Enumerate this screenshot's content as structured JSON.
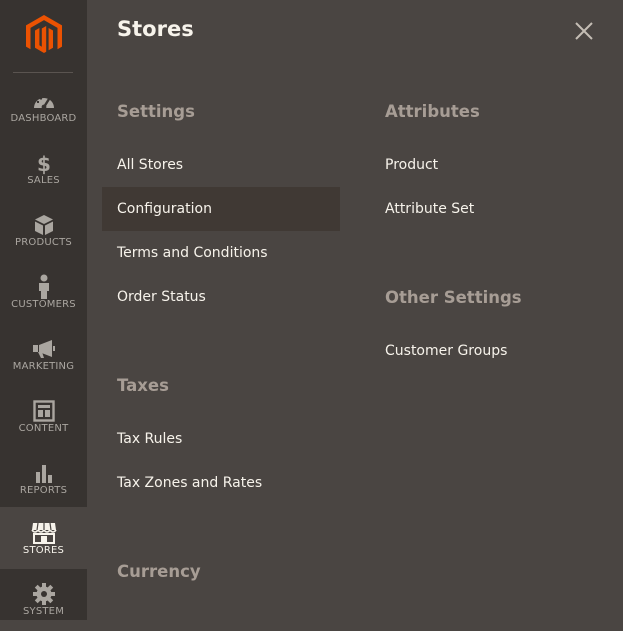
{
  "sidebar": {
    "logo": "magento-logo-icon",
    "items": [
      {
        "label": "DASHBOARD",
        "icon": "dashboard-gauge-icon"
      },
      {
        "label": "SALES",
        "icon": "dollar-icon"
      },
      {
        "label": "PRODUCTS",
        "icon": "box-icon"
      },
      {
        "label": "CUSTOMERS",
        "icon": "person-icon"
      },
      {
        "label": "MARKETING",
        "icon": "megaphone-icon"
      },
      {
        "label": "CONTENT",
        "icon": "layout-icon"
      },
      {
        "label": "REPORTS",
        "icon": "bar-chart-icon"
      },
      {
        "label": "STORES",
        "icon": "storefront-icon",
        "active": true
      },
      {
        "label": "SYSTEM",
        "icon": "gear-icon"
      }
    ]
  },
  "panel": {
    "title": "Stores",
    "close_icon": "close-icon",
    "settings": {
      "title": "Settings",
      "links": [
        "All Stores",
        "Configuration",
        "Terms and Conditions",
        "Order Status"
      ]
    },
    "taxes": {
      "title": "Taxes",
      "links": [
        "Tax Rules",
        "Tax Zones and Rates"
      ]
    },
    "currency": {
      "title": "Currency"
    },
    "attributes": {
      "title": "Attributes",
      "links": [
        "Product",
        "Attribute Set"
      ]
    },
    "other_settings": {
      "title": "Other Settings",
      "links": [
        "Customer Groups"
      ]
    }
  },
  "colors": {
    "sidebar_bg": "#373330",
    "panel_bg": "#4a4542",
    "brand_orange": "#eb5202",
    "section_title": "#a79d95",
    "link_text": "#f7f3eb"
  }
}
